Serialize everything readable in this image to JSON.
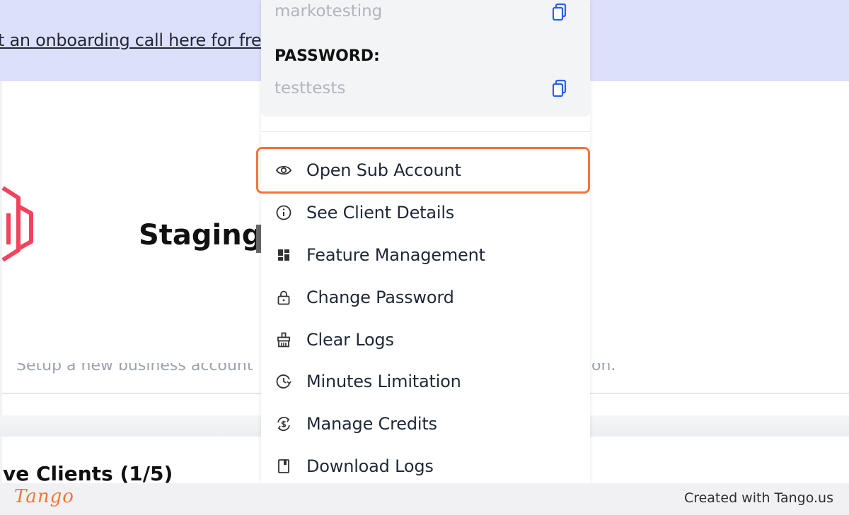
{
  "banner": {
    "link_text": "t an onboarding call here for free"
  },
  "page": {
    "title": "Staging",
    "setup_text": "Setup a new business account",
    "setup_tail": "on.",
    "clients_heading": "ve Clients (1/5)"
  },
  "dropdown": {
    "username_value": "markotesting",
    "password_label": "PASSWORD:",
    "password_value": "testtests",
    "items": [
      {
        "label": "Open Sub Account",
        "icon": "eye-icon"
      },
      {
        "label": "See Client Details",
        "icon": "info-icon"
      },
      {
        "label": "Feature Management",
        "icon": "dashboard-icon"
      },
      {
        "label": "Change Password",
        "icon": "lock-icon"
      },
      {
        "label": "Clear Logs",
        "icon": "broom-icon"
      },
      {
        "label": "Minutes Limitation",
        "icon": "clock-icon"
      },
      {
        "label": "Manage Credits",
        "icon": "credits-icon"
      },
      {
        "label": "Download Logs",
        "icon": "file-icon"
      }
    ]
  },
  "footer": {
    "brand": "Tango",
    "created_text": "Created with Tango.us"
  },
  "colors": {
    "highlight": "#f4743b",
    "banner": "#dde0fa",
    "copy_icon": "#2563eb",
    "logo": "#f0445c"
  }
}
